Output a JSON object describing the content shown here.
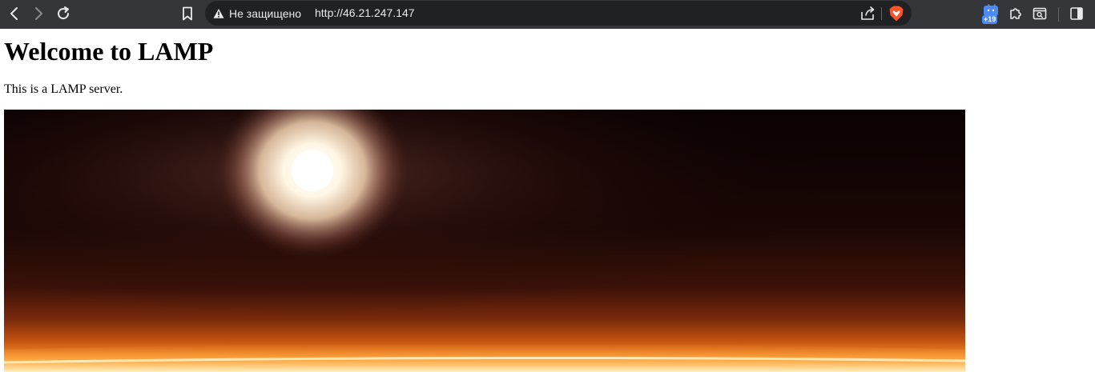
{
  "browser": {
    "security_label": "Не защищено",
    "url": "http://46.21.247.147",
    "extension_badge": "+19"
  },
  "colors": {
    "toolbar_bg": "#35363a",
    "omnibox_bg": "#202124",
    "toolbar_icon": "#e8eaed",
    "badge_blue": "#4c8bf5",
    "brave_orange": "#fb542b"
  },
  "icons": {
    "back": "back-arrow-icon",
    "forward": "forward-arrow-icon",
    "reload": "reload-icon",
    "bookmark": "bookmark-icon",
    "warning": "warning-triangle-icon",
    "share": "share-icon",
    "brave": "brave-shields-icon",
    "extension_badge": "extension-badge-icon",
    "extensions": "puzzle-icon",
    "search_tabs": "search-tabs-icon",
    "sidebar": "sidebar-toggle-icon"
  },
  "page": {
    "heading": "Welcome to LAMP",
    "paragraph": "This is a LAMP server.",
    "image": {
      "subject": "sunrise over planet horizon from space"
    }
  }
}
